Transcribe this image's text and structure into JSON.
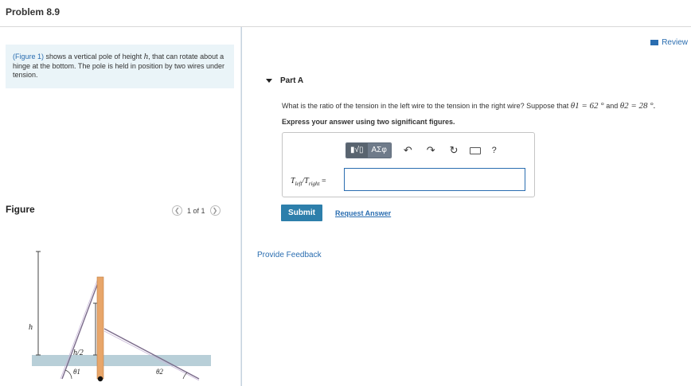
{
  "header": {
    "problem_title": "Problem 8.9"
  },
  "intro": {
    "link_text": "(Figure 1)",
    "text_before_h": " shows a vertical pole of height ",
    "h_symbol": "h",
    "text_after_h": ", that can rotate about a hinge at the bottom. The pole is held in position by two wires under tension."
  },
  "figure": {
    "label": "Figure",
    "pager_text": "1 of 1",
    "prev_icon": "chevron-left-icon",
    "next_icon": "chevron-right-icon",
    "label_h": "h",
    "label_half_h": "h/2",
    "label_theta1": "θ1",
    "label_theta2": "θ2",
    "colors": {
      "pole": "#e8a66a",
      "wire": "#7a6a8a",
      "ground": "#b8cfd8"
    }
  },
  "review": {
    "label": "Review",
    "icon": "book-icon"
  },
  "part": {
    "label": "Part A"
  },
  "question": {
    "text": "What is the ratio of the tension in the left wire to the tension in the right wire? Suppose that ",
    "theta1": "θ1 = 62 °",
    "and": " and ",
    "theta2": "θ2 = 28 °.",
    "instruction": "Express your answer using two significant figures."
  },
  "toolbar": {
    "template_btn": "▮√▯",
    "greek_btn": "ΑΣφ",
    "undo_icon": "undo-icon",
    "redo_icon": "redo-icon",
    "reset_icon": "reset-icon",
    "keyboard_icon": "keyboard-icon",
    "help_label": "?"
  },
  "answer": {
    "eq_T": "T",
    "eq_left_sub": "left",
    "eq_slash": "/",
    "eq_T2": "T",
    "eq_right_sub": "right",
    "eq_equals": " =",
    "value": ""
  },
  "actions": {
    "submit_label": "Submit",
    "request_label": "Request Answer",
    "feedback_label": "Provide Feedback"
  },
  "accent_color": "#2a6db0"
}
